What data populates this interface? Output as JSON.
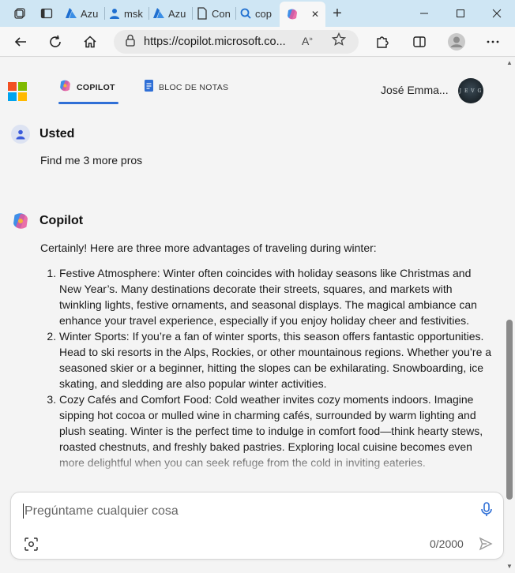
{
  "browser": {
    "tabs": [
      {
        "label": "",
        "icon": "workspaces-icon"
      },
      {
        "label": "",
        "icon": "tab-actions-icon"
      },
      {
        "label": "Azu",
        "icon": "azure-icon"
      },
      {
        "label": "msk",
        "icon": "person-icon"
      },
      {
        "label": "Azu",
        "icon": "azure-icon"
      },
      {
        "label": "Con",
        "icon": "document-icon"
      },
      {
        "label": "cop",
        "icon": "search-icon"
      }
    ],
    "active_tab_close": "✕",
    "url": "https://copilot.microsoft.co..."
  },
  "header": {
    "tab_copilot": "COPILOT",
    "tab_notebook": "BLOC DE NOTAS",
    "user_name": "José Emma...",
    "avatar_text": "J E V G"
  },
  "conversation": {
    "user_label": "Usted",
    "user_message": "Find me 3 more pros",
    "bot_label": "Copilot",
    "intro": "Certainly! Here are three more advantages of traveling during winter:",
    "items": [
      "Festive Atmosphere: Winter often coincides with holiday seasons like Christmas and New Year’s. Many destinations decorate their streets, squares, and markets with twinkling lights, festive ornaments, and seasonal displays. The magical ambiance can enhance your travel experience, especially if you enjoy holiday cheer and festivities.",
      "Winter Sports: If you’re a fan of winter sports, this season offers fantastic opportunities. Head to ski resorts in the Alps, Rockies, or other mountainous regions. Whether you’re a seasoned skier or a beginner, hitting the slopes can be exhilarating. Snowboarding, ice skating, and sledding are also popular winter activities.",
      "Cozy Cafés and Comfort Food: Cold weather invites cozy moments indoors. Imagine sipping hot cocoa or mulled wine in charming cafés, surrounded by warm lighting and plush seating. Winter is the perfect time to indulge in comfort food—think hearty stews, roasted chestnuts, and freshly baked pastries. Exploring local cuisine becomes even more delightful when you can seek refuge from the cold in inviting eateries."
    ]
  },
  "composer": {
    "placeholder": "Pregúntame cualquier cosa",
    "counter": "0/2000"
  },
  "colors": {
    "tabstrip": "#cfe6f4",
    "accent": "#2f6fd6"
  }
}
